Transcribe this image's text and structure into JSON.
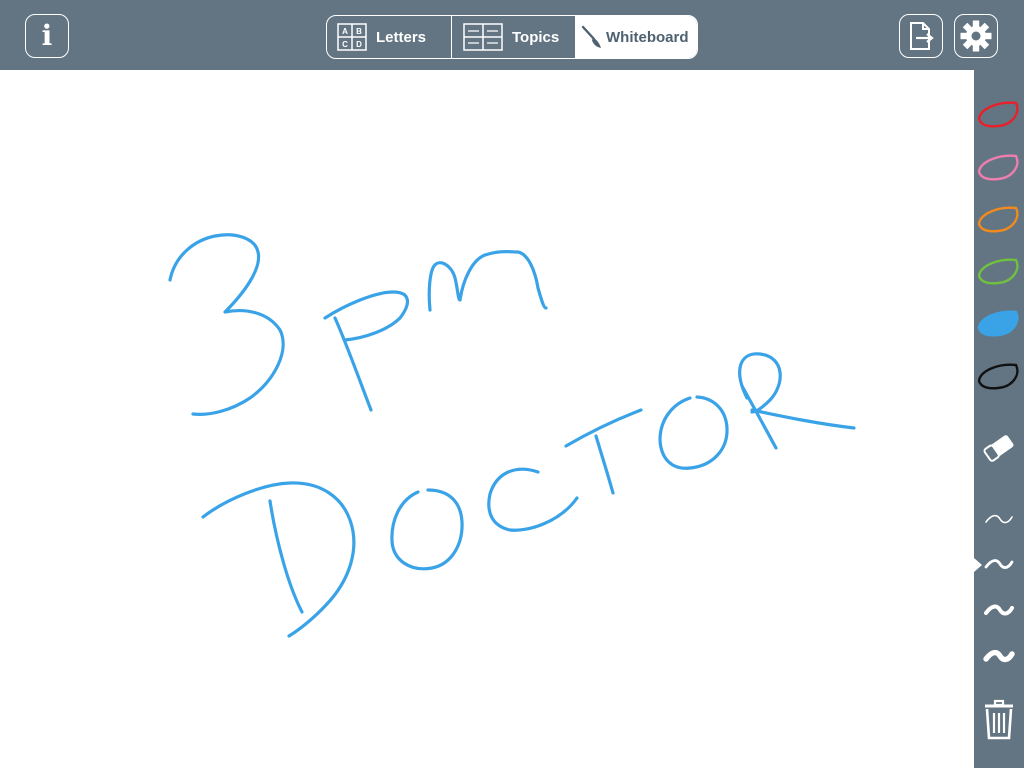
{
  "header": {
    "info_icon": "info-icon",
    "tabs": [
      {
        "label": "Letters",
        "icon": "letter-grid-icon",
        "grid": [
          "A",
          "B",
          "C",
          "D"
        ],
        "selected": false
      },
      {
        "label": "Topics",
        "icon": "topics-list-icon",
        "selected": false
      },
      {
        "label": "Whiteboard",
        "icon": "paintbrush-icon",
        "selected": true
      }
    ],
    "export_icon": "export-document-icon",
    "settings_icon": "gear-icon"
  },
  "whiteboard": {
    "drawing_text": [
      "3pm",
      "DOCTOR"
    ],
    "stroke_color": "#3aa3e8"
  },
  "toolbar": {
    "colors": [
      {
        "name": "red",
        "hex": "#e8202a",
        "selected": false
      },
      {
        "name": "pink",
        "hex": "#ef7eb0",
        "selected": false
      },
      {
        "name": "orange",
        "hex": "#f28a1e",
        "selected": false
      },
      {
        "name": "green",
        "hex": "#6fc13f",
        "selected": false
      },
      {
        "name": "blue",
        "hex": "#3aa3e8",
        "selected": true
      },
      {
        "name": "black",
        "hex": "#111111",
        "selected": false
      }
    ],
    "eraser_icon": "eraser-icon",
    "stroke_sizes": [
      {
        "name": "extra-thin",
        "selected": false
      },
      {
        "name": "thin",
        "selected": true
      },
      {
        "name": "medium",
        "selected": false
      },
      {
        "name": "thick",
        "selected": false
      }
    ],
    "trash_icon": "trash-icon"
  }
}
